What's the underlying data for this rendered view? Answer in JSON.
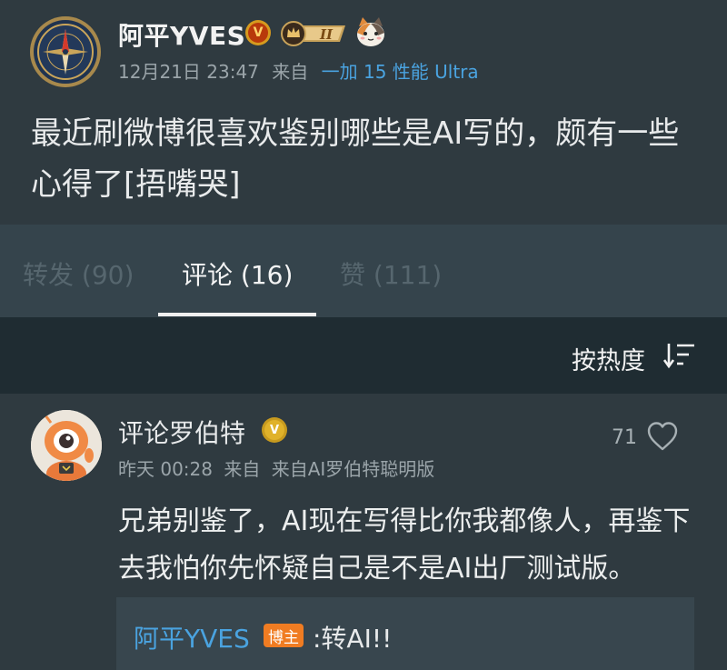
{
  "post": {
    "author": "阿平YVES",
    "verify_badge": "V",
    "rank_badge": "II",
    "date": "12月21日 23:47",
    "from_prefix": "来自",
    "source": "一加 15 性能 Ultra",
    "text": "最近刷微博很喜欢鉴别哪些是AI写的，颇有一些心得了[捂嘴哭]"
  },
  "tabs": [
    {
      "label": "转发 (90)",
      "active": false
    },
    {
      "label": "评论 (16)",
      "active": true
    },
    {
      "label": "赞 (111)",
      "active": false
    }
  ],
  "sort": {
    "label": "按热度",
    "icon": "sort-icon"
  },
  "comment": {
    "author": "评论罗伯特",
    "verify_badge": "V",
    "time": "昨天 00:28",
    "from_prefix": "来自",
    "source": "来自AI罗伯特聪明版",
    "likes": "71",
    "text": "兄弟别鉴了，AI现在写得比你我都像人，再鉴下去我怕你先怀疑自己是不是AI出厂测试版。",
    "reply": {
      "author": "阿平YVES",
      "badge": "博主",
      "text": ":转AI!!"
    }
  },
  "colors": {
    "background": "#2f3a40",
    "tabs_bg": "#35444c",
    "sortbar_bg": "#1f2c32",
    "link": "#4aa3e0",
    "author_badge": "#f07c22"
  }
}
